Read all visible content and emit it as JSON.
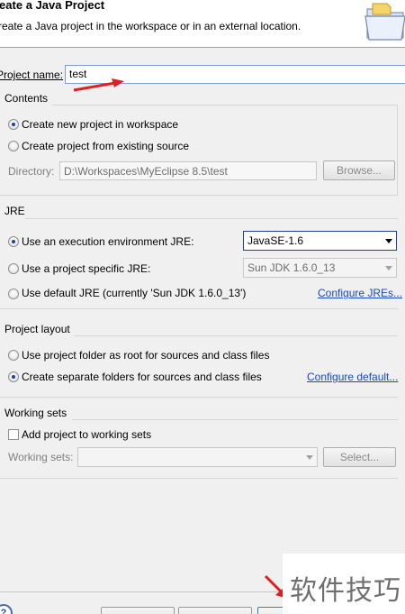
{
  "header": {
    "title": "reate a Java Project",
    "description": "reate a Java project in the workspace or in an external location."
  },
  "project": {
    "name_label": "Project name:",
    "name_value": "test"
  },
  "contents": {
    "group_label": "Contents",
    "option_new": "Create new project in workspace",
    "option_existing": "Create project from existing source",
    "directory_label": "Directory:",
    "directory_value": "D:\\Workspaces\\MyEclipse 8.5\\test",
    "browse_label": "Browse..."
  },
  "jre": {
    "group_label": "JRE",
    "option_exec_env": "Use an execution environment JRE:",
    "exec_env_value": "JavaSE-1.6",
    "option_specific": "Use a project specific JRE:",
    "specific_value": "Sun JDK 1.6.0_13",
    "option_default": "Use default JRE (currently 'Sun JDK 1.6.0_13')",
    "configure_link": "Configure JREs..."
  },
  "layout": {
    "group_label": "Project layout",
    "option_root": "Use project folder as root for sources and class files",
    "option_separate": "Create separate folders for sources and class files",
    "configure_link": "Configure default..."
  },
  "working_sets": {
    "group_label": "Working sets",
    "add_label": "Add project to working sets",
    "sets_label": "Working sets:",
    "select_label": "Select..."
  },
  "watermark": {
    "text": "软件技巧"
  },
  "colors": {
    "accent_arrow": "#e02020",
    "link": "#1a48c4"
  }
}
